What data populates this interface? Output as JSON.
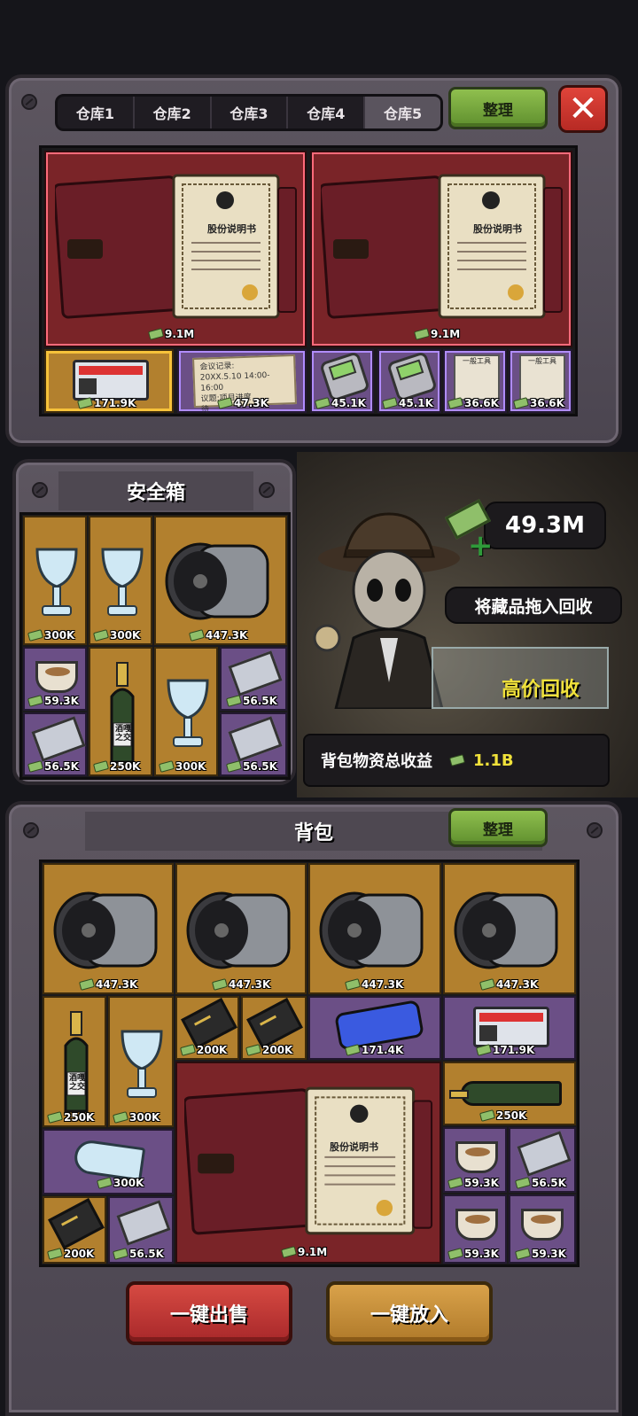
{
  "warehouse": {
    "tabs": [
      "仓库1",
      "仓库2",
      "仓库3",
      "仓库4",
      "仓库5"
    ],
    "active_tab_index": 4,
    "sort_label": "整理",
    "close_icon": "close-icon",
    "items": [
      {
        "name": "股份说明书",
        "value": "9.1M"
      },
      {
        "name": "股份说明书",
        "value": "9.1M"
      },
      {
        "name": "监控屏",
        "value": "171.9K"
      },
      {
        "name": "会议记录",
        "value": "47.3K",
        "text_lines": [
          "会议记录:",
          "20XX.5.10 14:00-16:00",
          "议题:项目进度",
          "待"
        ]
      },
      {
        "name": "计算器",
        "value": "45.1K"
      },
      {
        "name": "计算器",
        "value": "45.1K"
      },
      {
        "name": "一般工具",
        "value": "36.6K",
        "tag": "一般工具"
      },
      {
        "name": "一般工具",
        "value": "36.6K",
        "tag": "一般工具"
      }
    ]
  },
  "safe": {
    "title": "安全箱",
    "items": [
      {
        "name": "奖杯",
        "value": "300K"
      },
      {
        "name": "奖杯",
        "value": "300K"
      },
      {
        "name": "涡轮",
        "value": "447.3K"
      },
      {
        "name": "咖啡",
        "value": "59.3K"
      },
      {
        "name": "香槟",
        "value": "250K",
        "label": "酒嘎之交"
      },
      {
        "name": "奖杯",
        "value": "300K"
      },
      {
        "name": "杂志",
        "value": "56.5K"
      },
      {
        "name": "杂志",
        "value": "56.5K"
      },
      {
        "name": "杂志",
        "value": "56.5K"
      }
    ]
  },
  "recycle": {
    "money": "49.3M",
    "drag_hint": "将藏品拖入回收",
    "high_price": "高价回收",
    "total_label": "背包物资总收益",
    "total_value": "1.1B"
  },
  "backpack": {
    "title": "背包",
    "sort_label": "整理",
    "items": [
      {
        "name": "涡轮",
        "value": "447.3K"
      },
      {
        "name": "涡轮",
        "value": "447.3K"
      },
      {
        "name": "涡轮",
        "value": "447.3K"
      },
      {
        "name": "涡轮",
        "value": "447.3K"
      },
      {
        "name": "香槟",
        "value": "250K",
        "label": "酒嘎之交"
      },
      {
        "name": "奖杯",
        "value": "300K"
      },
      {
        "name": "金卡",
        "value": "200K"
      },
      {
        "name": "金卡",
        "value": "200K"
      },
      {
        "name": "手机",
        "value": "171.4K"
      },
      {
        "name": "监控屏",
        "value": "171.9K"
      },
      {
        "name": "股份说明书",
        "value": "9.1M"
      },
      {
        "name": "香槟",
        "value": "250K"
      },
      {
        "name": "倒地奖杯",
        "value": "300K"
      },
      {
        "name": "咖啡",
        "value": "59.3K"
      },
      {
        "name": "杂志",
        "value": "56.5K"
      },
      {
        "name": "金卡",
        "value": "200K"
      },
      {
        "name": "杂志",
        "value": "56.5K"
      },
      {
        "name": "咖啡",
        "value": "59.3K"
      },
      {
        "name": "咖啡",
        "value": "59.3K"
      }
    ]
  },
  "actions": {
    "sell_all": "一键出售",
    "put_all": "一键放入"
  },
  "document_title": "股份说明书"
}
